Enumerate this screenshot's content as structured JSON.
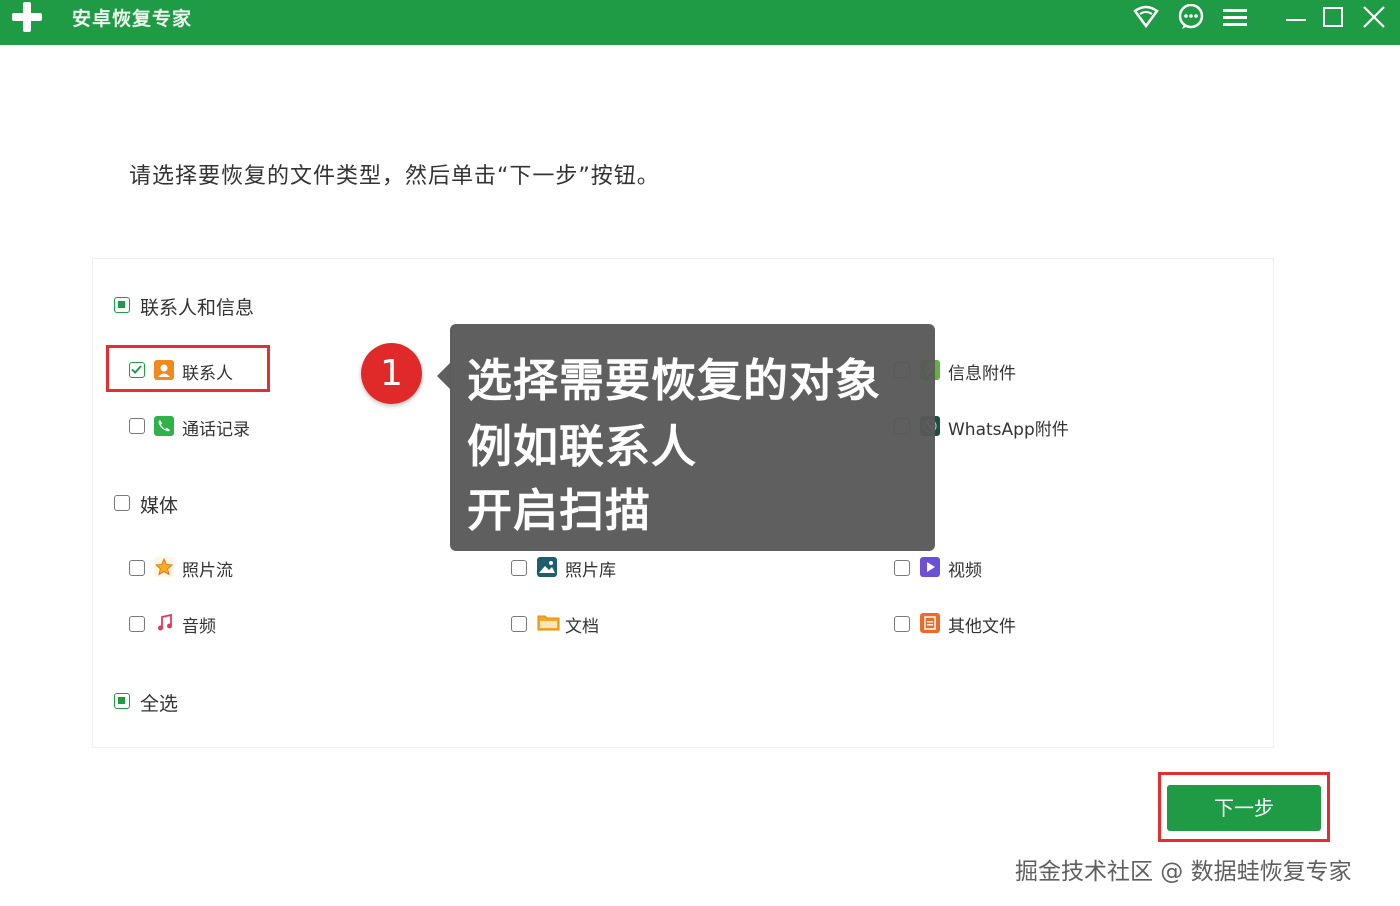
{
  "window": {
    "title": "安卓恢复专家",
    "icons": [
      "wifi-icon",
      "chat-icon",
      "menu-icon",
      "minimize-icon",
      "maximize-icon",
      "close-icon"
    ]
  },
  "instruction": "请选择要恢复的文件类型，然后单击“下一步”按钮。",
  "groups": {
    "contacts_messages": {
      "label": "联系人和信息",
      "state": "partial",
      "items": {
        "contacts": {
          "label": "联系人",
          "checked": true,
          "icon": "contact-icon"
        },
        "call_log": {
          "label": "通话记录",
          "checked": false,
          "icon": "phone-icon"
        },
        "msg_attach": {
          "label": "信息附件",
          "checked": false,
          "icon": "attachment-icon"
        },
        "whatsapp_attach": {
          "label": "WhatsApp附件",
          "checked": false,
          "icon": "whatsapp-icon"
        }
      }
    },
    "media": {
      "label": "媒体",
      "state": "unchecked",
      "items": {
        "photo_stream": {
          "label": "照片流",
          "checked": false,
          "icon": "star-icon"
        },
        "photo_library": {
          "label": "照片库",
          "checked": false,
          "icon": "image-icon"
        },
        "video": {
          "label": "视频",
          "checked": false,
          "icon": "video-icon"
        },
        "audio": {
          "label": "音频",
          "checked": false,
          "icon": "music-icon"
        },
        "documents": {
          "label": "文档",
          "checked": false,
          "icon": "folder-icon"
        },
        "other_files": {
          "label": "其他文件",
          "checked": false,
          "icon": "file-icon"
        }
      }
    }
  },
  "select_all": {
    "label": "全选",
    "state": "partial"
  },
  "next_button": "下一步",
  "annotation": {
    "step": "1",
    "lines": [
      "选择需要恢复的对象",
      "例如联系人",
      "开启扫描"
    ]
  },
  "watermark": "掘金技术社区 @ 数据蛙恢复专家",
  "colors": {
    "brand": "#1f9a45",
    "highlight": "#e23030"
  }
}
